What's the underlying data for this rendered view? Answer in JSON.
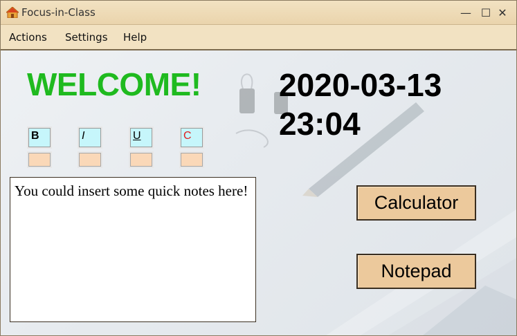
{
  "window": {
    "title": "Focus-in-Class",
    "controls": {
      "minimize": "—",
      "maximize": "☐",
      "close": "✕"
    }
  },
  "menu": {
    "items": [
      "Actions",
      "Settings",
      "Help"
    ]
  },
  "main": {
    "welcome": "WELCOME!",
    "date": "2020-03-13",
    "time": "23:04",
    "format_buttons": [
      {
        "label": "B",
        "style": "bold"
      },
      {
        "label": "I",
        "style": "italic"
      },
      {
        "label": "U",
        "style": "underline"
      },
      {
        "label": "C",
        "style": "color"
      }
    ],
    "notes_text": "You could insert some quick notes here!",
    "calculator_label": "Calculator",
    "notepad_label": "Notepad"
  },
  "colors": {
    "welcome": "#1fba1f",
    "format_button_bg": "#c6f6fb",
    "format_sub_bg": "#fad8b8",
    "big_button_bg": "#ecc99c",
    "titlebar_bg": "#f2e2c2",
    "color_button_text": "#e02020"
  },
  "icons": {
    "app": "home-icon",
    "minimize": "minimize-icon",
    "maximize": "maximize-icon",
    "close": "close-icon"
  }
}
